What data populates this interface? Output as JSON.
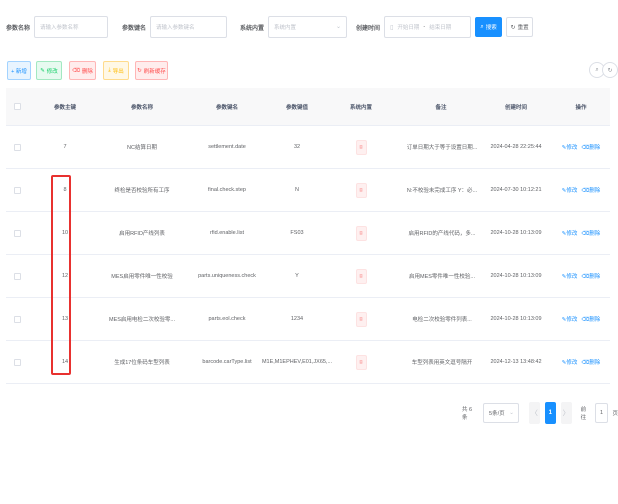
{
  "search": {
    "param_name_label": "参数名称",
    "param_name_placeholder": "请输入参数名称",
    "param_key_label": "参数键名",
    "param_key_placeholder": "请输入参数键名",
    "builtin_label": "系统内置",
    "builtin_placeholder": "系统内置",
    "created_label": "创建时间",
    "start_placeholder": "开始日期",
    "range_separator": "-",
    "end_placeholder": "结束日期",
    "search_button": "搜索",
    "reset_button": "重置"
  },
  "toolbar": {
    "add": "+ 新增",
    "edit": "修改",
    "delete": "删除",
    "export": "导出",
    "refresh_cache": "刷新缓存"
  },
  "table": {
    "headers": [
      "参数主键",
      "参数名称",
      "参数键名",
      "参数键值",
      "系统内置",
      "备注",
      "创建时间",
      "操作"
    ],
    "tag_label": "否",
    "action_edit": "修改",
    "action_delete": "删除",
    "rows": [
      {
        "id": "7",
        "name": "NC结算日期",
        "key": "settlement.date",
        "value": "32",
        "remark": "订单日期大于等于设置日期...",
        "created": "2024-04-28 22:25:44"
      },
      {
        "id": "8",
        "name": "终检是否校验所有工序",
        "key": "final.check.step",
        "value": "N",
        "remark": "N:不校验未完成工序 Y：必...",
        "created": "2024-07-30 10:12:21"
      },
      {
        "id": "10",
        "name": "启用RFID产线列表",
        "key": "rfid.enable.list",
        "value": "FS03",
        "remark": "启用RFID的产线代码，多...",
        "created": "2024-10-28 10:13:09"
      },
      {
        "id": "12",
        "name": "MES启用零件唯一性校验",
        "key": "parts.uniqueness.check",
        "value": "Y",
        "remark": "启用MES零件唯一性校验...",
        "created": "2024-10-28 10:13:09"
      },
      {
        "id": "13",
        "name": "MES启用电检二次校验零...",
        "key": "parts.eol.check",
        "value": "1234",
        "remark": "电检二次校验零件列表...",
        "created": "2024-10-28 10:13:09"
      },
      {
        "id": "14",
        "name": "生成17位条码车型列表",
        "key": "barcode.carType.list",
        "value": "M1E,M1EPHEV,E01,JX65,...",
        "remark": "车型列表用英文逗号隔开",
        "created": "2024-12-13 13:48:42"
      }
    ]
  },
  "pagination": {
    "total": "共 6 条",
    "page_size": "5条/页",
    "prev": "〈",
    "current": "1",
    "next": "〉",
    "goto_label": "前往",
    "goto_value": "1",
    "page_unit": "页"
  }
}
